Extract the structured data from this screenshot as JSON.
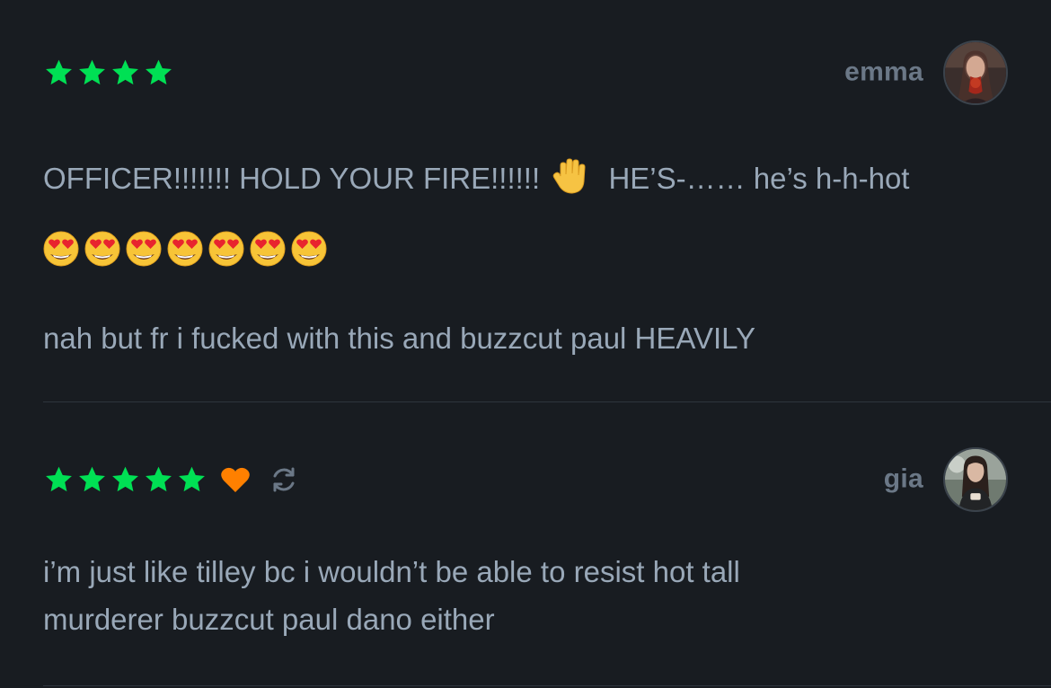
{
  "reviews": [
    {
      "username": "emma",
      "rating": 4,
      "liked": false,
      "rewatch": false,
      "text_line_1_before": "OFFICER!!!!!!! HOLD YOUR FIRE!!!!!!",
      "text_line_1_emoji": "raised-hand",
      "text_line_1_after": "HE’S-…… he’s h-h-hot",
      "emoji_line": [
        "heart-eyes",
        "heart-eyes",
        "heart-eyes",
        "heart-eyes",
        "heart-eyes",
        "heart-eyes",
        "heart-eyes"
      ],
      "text_line_3": "nah but fr i fucked with this and buzzcut paul HEAVILY"
    },
    {
      "username": "gia",
      "rating": 5,
      "liked": true,
      "rewatch": true,
      "text_line_1": "i’m just like tilley bc i wouldn’t be able to resist hot tall",
      "text_line_2": "murderer buzzcut paul dano either"
    }
  ],
  "colors": {
    "background": "#181c21",
    "star": "#00e054",
    "heart": "#ff8000",
    "username": "#6b7887",
    "body_text": "#99a8b8",
    "divider": "#2e353d"
  }
}
